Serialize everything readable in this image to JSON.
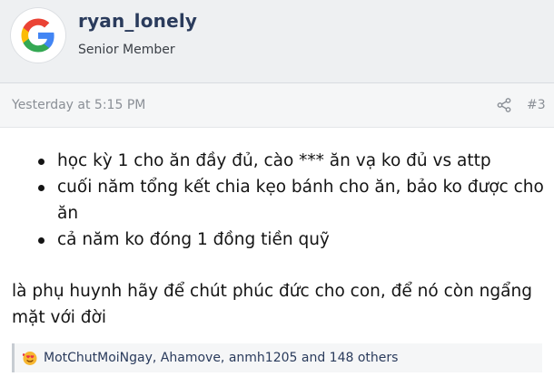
{
  "user": {
    "name": "ryan_lonely",
    "title": "Senior Member",
    "avatar_icon": "google-g-icon"
  },
  "post": {
    "timestamp": "Yesterday at 5:15 PM",
    "share_icon": "share-icon",
    "number": "#3",
    "bullets": [
      "học kỳ 1 cho ăn đầy đủ, cào *** ăn vạ ko đủ vs attp",
      "cuối năm tổng kết chia kẹo bánh cho ăn, bảo ko được cho ăn",
      "cả năm ko đóng 1 đồng tiền quỹ"
    ],
    "body": "là phụ huynh hãy để chút phúc đức cho con, để nó còn ngẩng mặt với đời"
  },
  "reactions": {
    "icon": "love-face-emoji-icon",
    "text": "MotChutMoiNgay, Ahamove, anmh1205 and 148 others"
  },
  "colors": {
    "header_bg": "#eef0f2",
    "username": "#2a3b5c",
    "meta_text": "#8a8f96"
  }
}
